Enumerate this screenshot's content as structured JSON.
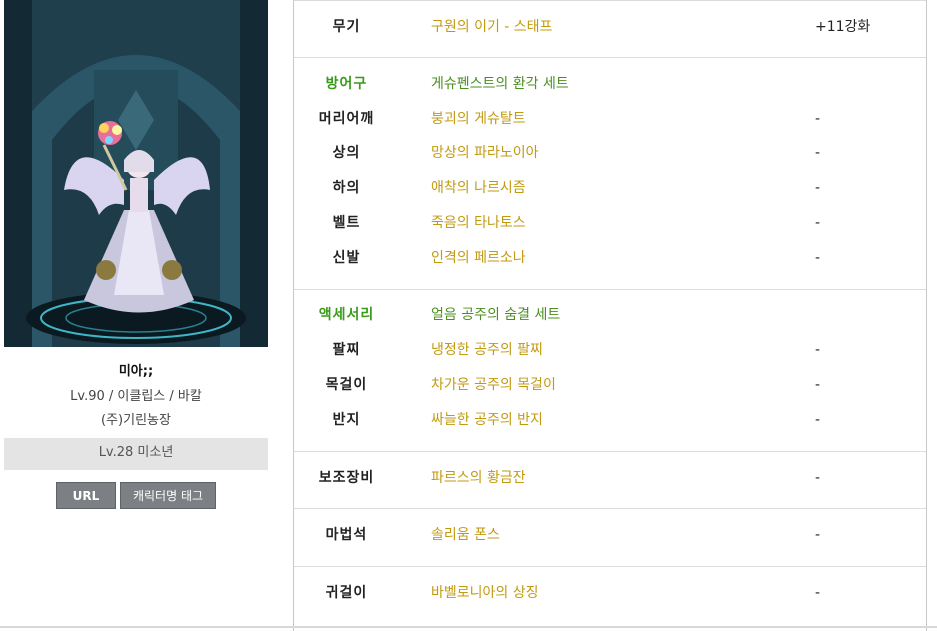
{
  "character": {
    "name": "미아;;",
    "info": "Lv.90 / 이클립스 / 바칼",
    "guild": "(주)기린농장",
    "pet": "Lv.28 미소년"
  },
  "buttons": {
    "url": "URL",
    "tag": "캐릭터명 태그"
  },
  "weapon": {
    "slot": "무기",
    "name": "구원의 이기 - 스태프",
    "enhance": "+11강화"
  },
  "armor": {
    "header_slot": "방어구",
    "set_name": "게슈펜스트의 환각 세트",
    "items": [
      {
        "slot": "머리어깨",
        "name": "붕괴의 게슈탈트",
        "enhance": "-"
      },
      {
        "slot": "상의",
        "name": "망상의 파라노이아",
        "enhance": "-"
      },
      {
        "slot": "하의",
        "name": "애착의 나르시즘",
        "enhance": "-"
      },
      {
        "slot": "벨트",
        "name": "죽음의 타나토스",
        "enhance": "-"
      },
      {
        "slot": "신발",
        "name": "인격의 페르소나",
        "enhance": "-"
      }
    ]
  },
  "accessory": {
    "header_slot": "액세서리",
    "set_name": "얼음 공주의 숨결 세트",
    "items": [
      {
        "slot": "팔찌",
        "name": "냉정한 공주의 팔찌",
        "enhance": "-"
      },
      {
        "slot": "목걸이",
        "name": "차가운 공주의 목걸이",
        "enhance": "-"
      },
      {
        "slot": "반지",
        "name": "싸늘한 공주의 반지",
        "enhance": "-"
      }
    ]
  },
  "sub": {
    "slot": "보조장비",
    "name": "파르스의 황금잔",
    "enhance": "-"
  },
  "magic": {
    "slot": "마법석",
    "name": "솔리움 폰스",
    "enhance": "-"
  },
  "earring": {
    "slot": "귀걸이",
    "name": "바벨로니아의 상징",
    "enhance": "-"
  },
  "colors": {
    "item": "#c29a10",
    "set": "#4a8f1f",
    "button": "#7c7f83",
    "pet_bg": "#e4e4e4"
  }
}
